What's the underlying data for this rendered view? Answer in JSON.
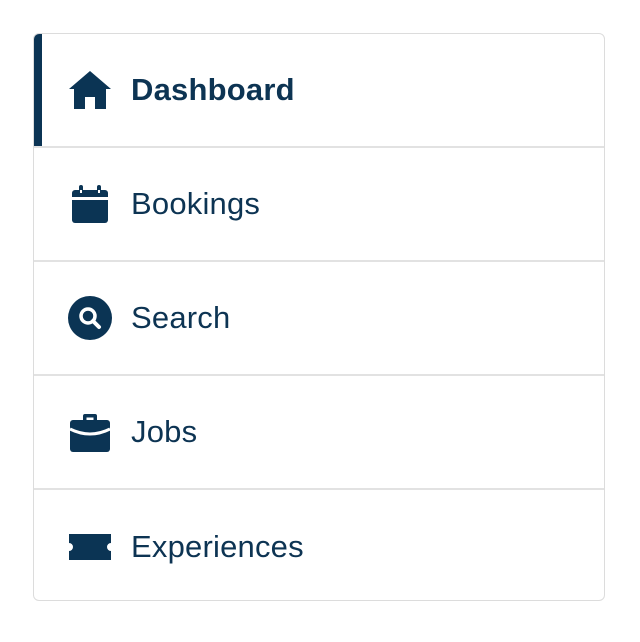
{
  "nav": {
    "accent_color": "#0b3454",
    "text_color": "#0d3453",
    "items": [
      {
        "label": "Dashboard",
        "icon": "home-icon",
        "active": true
      },
      {
        "label": "Bookings",
        "icon": "calendar-icon",
        "active": false
      },
      {
        "label": "Search",
        "icon": "search-icon",
        "active": false
      },
      {
        "label": "Jobs",
        "icon": "briefcase-icon",
        "active": false
      },
      {
        "label": "Experiences",
        "icon": "ticket-icon",
        "active": false
      }
    ]
  }
}
